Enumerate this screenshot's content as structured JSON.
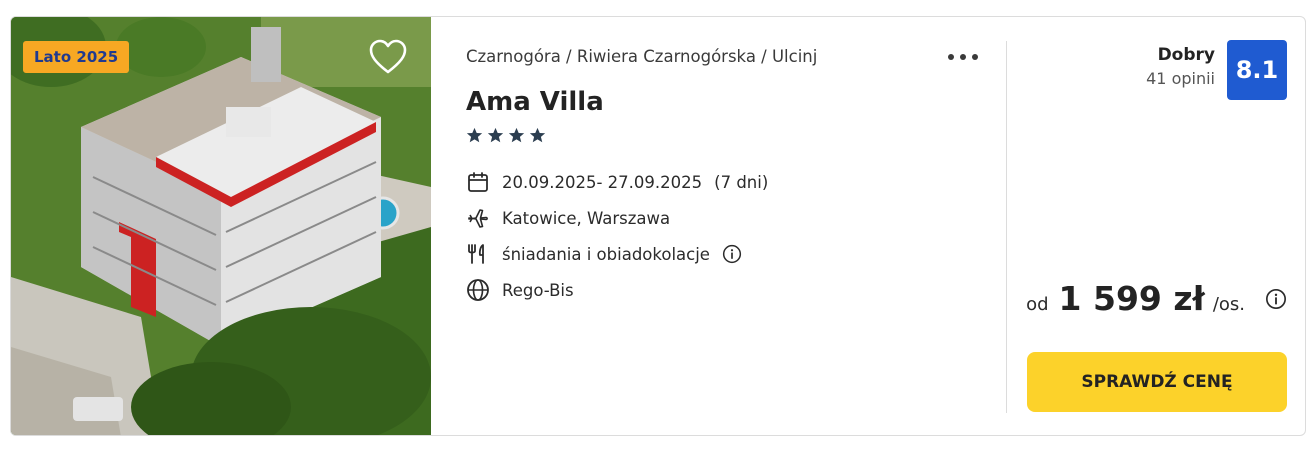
{
  "offer": {
    "season_badge": "Lato 2025",
    "breadcrumb": "Czarnogóra / Riwiera Czarnogórska / Ulcinj",
    "hotel_name": "Ama Villa",
    "stars": 4,
    "dates": "20.09.2025- 27.09.2025",
    "duration": "(7 dni)",
    "departure": "Katowice, Warszawa",
    "board": "śniadania i obiadokolacje",
    "operator": "Rego-Bis"
  },
  "rating": {
    "label": "Dobry",
    "reviews": "41 opinii",
    "score": "8.1"
  },
  "price": {
    "prefix": "od",
    "amount": "1 599 zł",
    "suffix": "/os."
  },
  "cta": {
    "label": "SPRAWDŹ CENĘ"
  },
  "icons": {
    "favorite": "heart-icon",
    "more": "more-dots-icon",
    "star": "star-icon",
    "dates": "calendar-icon",
    "departure": "plane-icon",
    "board": "cutlery-icon",
    "info": "info-icon",
    "operator": "globe-icon"
  },
  "colors": {
    "badge_bg": "#f7a823",
    "badge_text": "#203a8f",
    "score_bg": "#1f5bd1",
    "cta_bg": "#fcd22a"
  }
}
